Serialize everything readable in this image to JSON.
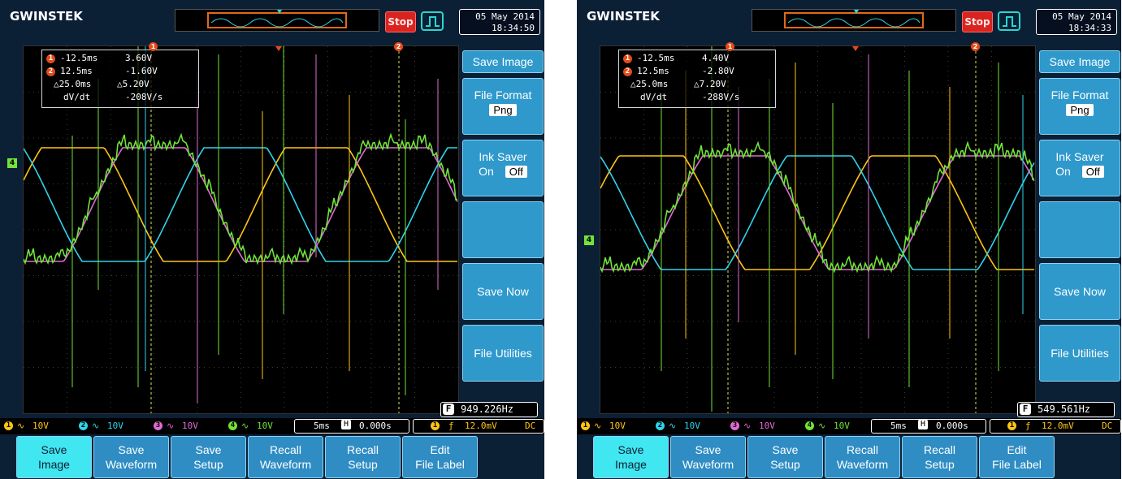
{
  "colors": {
    "ch1": "#ffc515",
    "ch2": "#2fd4ec",
    "ch3": "#e06bd6",
    "ch4": "#71e33a",
    "menu_button": "#2f99cc",
    "active_softkey": "#40e6f0",
    "stop": "#d9231f"
  },
  "screens": [
    {
      "logo": "GWINSTEK",
      "run_state": "Stop",
      "trigger_icon": "trigger-edge-icon",
      "date": "05 May 2014",
      "time": "18:34:50",
      "measurements": {
        "row1_label": "-12.5ms",
        "row1_value": "3.60V",
        "row2_label": "12.5ms",
        "row2_value": "-1.60V",
        "row3_label": "△25.0ms",
        "row3_value": "△5.20V",
        "row4_label": "dV/dt",
        "row4_value": "-208V/s"
      },
      "cursor1_marker": "1",
      "cursor2_marker": "2",
      "ch_marker_left": "4",
      "frequency": "949.226Hz",
      "freq_icon": "F",
      "menu": {
        "title": "Save Image",
        "file_format_label": "File Format",
        "file_format_value": "Png",
        "ink_saver_label": "Ink Saver",
        "ink_saver_on": "On",
        "ink_saver_off": "Off",
        "blank": "",
        "save_now": "Save Now",
        "file_utilities": "File Utilities"
      },
      "status": {
        "ch1_num": "1",
        "ch1_scale": "10V",
        "ch2_num": "2",
        "ch2_scale": "10V",
        "ch3_num": "3",
        "ch3_scale": "10V",
        "ch4_num": "4",
        "ch4_scale": "10V",
        "timebase": "5ms",
        "h_icon": "H",
        "h_pos": "0.000s",
        "trig_src": "1",
        "trig_level": "12.0mV",
        "coupling": "DC"
      },
      "softkeys": [
        {
          "l1": "Save",
          "l2": "Image"
        },
        {
          "l1": "Save",
          "l2": "Waveform"
        },
        {
          "l1": "Save",
          "l2": "Setup"
        },
        {
          "l1": "Recall",
          "l2": "Waveform"
        },
        {
          "l1": "Recall",
          "l2": "Setup"
        },
        {
          "l1": "Edit",
          "l2": "File Label"
        }
      ]
    },
    {
      "logo": "GWINSTEK",
      "run_state": "Stop",
      "trigger_icon": "trigger-edge-icon",
      "date": "05 May 2014",
      "time": "18:34:33",
      "measurements": {
        "row1_label": "-12.5ms",
        "row1_value": "4.40V",
        "row2_label": "12.5ms",
        "row2_value": "-2.80V",
        "row3_label": "△25.0ms",
        "row3_value": "△7.20V",
        "row4_label": "dV/dt",
        "row4_value": "-288V/s"
      },
      "cursor1_marker": "1",
      "cursor2_marker": "2",
      "ch_marker_left": "4",
      "frequency": "549.561Hz",
      "freq_icon": "F",
      "menu": {
        "title": "Save Image",
        "file_format_label": "File Format",
        "file_format_value": "Png",
        "ink_saver_label": "Ink Saver",
        "ink_saver_on": "On",
        "ink_saver_off": "Off",
        "blank": "",
        "save_now": "Save Now",
        "file_utilities": "File Utilities"
      },
      "status": {
        "ch1_num": "1",
        "ch1_scale": "10V",
        "ch2_num": "2",
        "ch2_scale": "10V",
        "ch3_num": "3",
        "ch3_scale": "10V",
        "ch4_num": "4",
        "ch4_scale": "10V",
        "timebase": "5ms",
        "h_icon": "H",
        "h_pos": "0.000s",
        "trig_src": "1",
        "trig_level": "12.0mV",
        "coupling": "DC"
      },
      "softkeys": [
        {
          "l1": "Save",
          "l2": "Image"
        },
        {
          "l1": "Save",
          "l2": "Waveform"
        },
        {
          "l1": "Save",
          "l2": "Setup"
        },
        {
          "l1": "Recall",
          "l2": "Waveform"
        },
        {
          "l1": "Recall",
          "l2": "Setup"
        },
        {
          "l1": "Edit",
          "l2": "File Label"
        }
      ]
    }
  ]
}
